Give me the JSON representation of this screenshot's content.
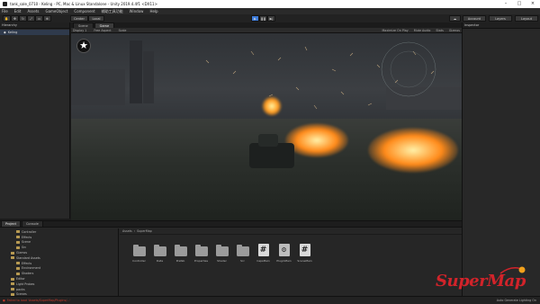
{
  "window": {
    "title": "tank_sale_0710 - Keling - PC, Mac & Linux Standalone - Unity 2019.4.4f1 <DX11>"
  },
  "menu": [
    "File",
    "Edit",
    "Assets",
    "GameObject",
    "Component",
    "辅助工具功能",
    "Window",
    "Help"
  ],
  "toolbar": {
    "center_label": "Center",
    "local_label": "Local",
    "account_label": "Account",
    "layers_label": "Layers",
    "layout_label": "Layout"
  },
  "hierarchy": {
    "tab": "Hierarchy",
    "root": "Keling"
  },
  "viewport": {
    "tabs": [
      "Scene",
      "Game"
    ],
    "display": "Display 1",
    "aspect": "Free Aspect",
    "scale": "Scale",
    "options": [
      "Maximize On Play",
      "Mute Audio",
      "Stats",
      "Gizmos"
    ]
  },
  "inspector": {
    "tab": "Inspector"
  },
  "project": {
    "tabs": [
      "Project",
      "Console"
    ],
    "breadcrumb": [
      "Assets",
      "SuperMap"
    ],
    "tree": [
      "Controller",
      "Effects",
      "Scene",
      "Src",
      "Gizmos",
      "Standard Assets",
      "Effects",
      "Environment",
      "Shaders",
      "Editor",
      "Light Probes",
      "packs",
      "Scenes",
      "SuperMap",
      "Packages"
    ],
    "assets": [
      {
        "name": "Controller",
        "kind": "folder"
      },
      {
        "name": "Data",
        "kind": "folder"
      },
      {
        "name": "Prefab",
        "kind": "folder"
      },
      {
        "name": "Properties",
        "kind": "folder"
      },
      {
        "name": "Shader",
        "kind": "folder"
      },
      {
        "name": "Src",
        "kind": "folder"
      },
      {
        "name": "CapsMain",
        "kind": "script"
      },
      {
        "name": "PluginMain",
        "kind": "file"
      },
      {
        "name": "SceneMain",
        "kind": "script"
      }
    ]
  },
  "status": {
    "message": "Failed to load 'Assets/SuperMap/Plugins/...' ",
    "right": "Auto Generate Lighting On"
  },
  "watermark": {
    "text": "SuperMap"
  },
  "colors": {
    "accent": "#3d7bd9",
    "fire": "#ff8a1a",
    "brand_red": "#d2232a"
  }
}
